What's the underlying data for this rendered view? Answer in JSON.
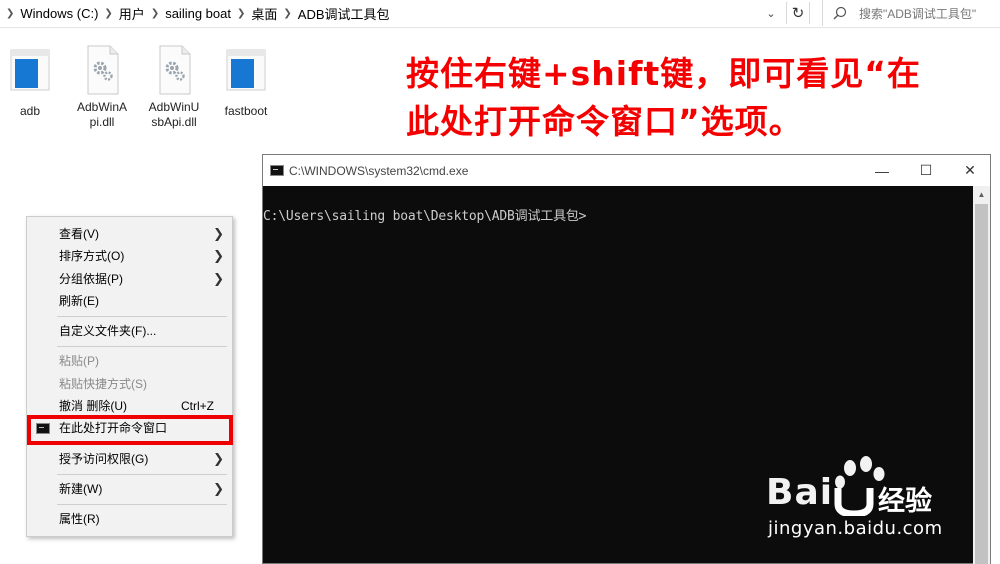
{
  "address_bar": {
    "breadcrumbs": [
      "Windows (C:)",
      "用户",
      "sailing boat",
      "桌面",
      "ADB调试工具包"
    ],
    "search_placeholder": "搜索\"ADB调试工具包\""
  },
  "files": [
    {
      "name": "adb",
      "icon": "blue-app-icon"
    },
    {
      "name": "AdbWinApi.dll",
      "line1": "AdbWinA",
      "line2": "pi.dll",
      "icon": "gear-dll-icon"
    },
    {
      "name": "AdbWinUsbApi.dll",
      "line1": "AdbWinU",
      "line2": "sbApi.dll",
      "icon": "gear-dll-icon"
    },
    {
      "name": "fastboot",
      "icon": "blue-app-icon"
    }
  ],
  "headline": {
    "line1": "按住右键+shift键，即可看见“在",
    "line2": "此处打开命令窗口”选项。",
    "color": "#f40000"
  },
  "context_menu": {
    "items": [
      {
        "label": "查看(V)",
        "submenu": true
      },
      {
        "label": "排序方式(O)",
        "submenu": true
      },
      {
        "label": "分组依据(P)",
        "submenu": true
      },
      {
        "label": "刷新(E)"
      },
      {
        "label": "自定义文件夹(F)..."
      },
      {
        "label": "粘贴(P)",
        "disabled": true
      },
      {
        "label": "粘贴快捷方式(S)",
        "disabled": true
      },
      {
        "label": "撤消 删除(U)",
        "accelerator": "Ctrl+Z"
      },
      {
        "label": "在此处打开命令窗口",
        "icon": "cmd-icon",
        "highlighted": true
      },
      {
        "label": "授予访问权限(G)",
        "submenu": true
      },
      {
        "label": "新建(W)",
        "submenu": true
      },
      {
        "label": "属性(R)"
      }
    ],
    "highlight_color": "#ee0000"
  },
  "cmd_window": {
    "title": "C:\\WINDOWS\\system32\\cmd.exe",
    "prompt": "C:\\Users\\sailing boat\\Desktop\\ADB调试工具包>",
    "minimize": "—",
    "maximize": "☐",
    "close": "✕"
  },
  "watermark": {
    "logo_left": "Bai",
    "logo_right": "经验",
    "url": "jingyan.baidu.com"
  }
}
